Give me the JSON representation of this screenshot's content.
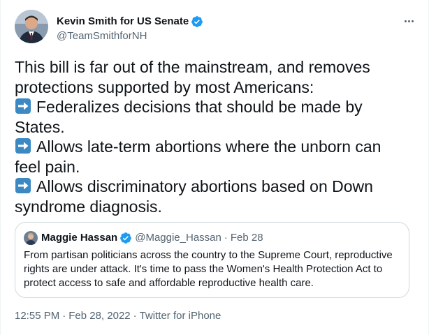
{
  "author": {
    "display_name": "Kevin Smith for US Senate",
    "handle": "@TeamSmithforNH",
    "avatar_icon": "person-photo-avatar",
    "verified_icon": "verified-badge-icon",
    "verified_color": "#1d9bf0"
  },
  "more_icon": "more-options-icon",
  "tweet": {
    "lines": [
      "This bill is far out of the mainstream, and removes",
      "protections supported by most Americans:",
      "Federalizes decisions that should be made by",
      "States.",
      "Allows late-term abortions where the unborn can",
      "feel pain.",
      "Allows discriminatory abortions based on Down",
      "syndrome diagnosis."
    ],
    "bullet_icon": "right-arrow-emoji-icon",
    "bullet_color": "#3b88c3"
  },
  "quoted_tweet": {
    "display_name": "Maggie Hassan",
    "handle": "@Maggie_Hassan",
    "separator": "·",
    "date": "Feb 28",
    "lines": [
      "From partisan politicians across the country to the Supreme Court, reproductive",
      "rights are under attack. It's time to pass the Women's Health Protection Act to",
      "protect access to safe and affordable reproductive health care."
    ]
  },
  "meta": {
    "time": "12:55 PM",
    "separator": "·",
    "date": "Feb 28, 2022",
    "source": "Twitter for iPhone"
  },
  "colors": {
    "text": "#0f1419",
    "secondary": "#536471",
    "border": "#cfd9de"
  }
}
